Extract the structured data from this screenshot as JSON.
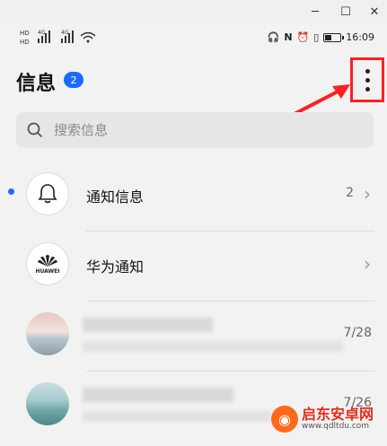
{
  "window": {
    "minimize": "─",
    "maximize": "☐",
    "close": "✕"
  },
  "status_bar": {
    "left_icons": [
      "HD",
      "4G",
      "4G",
      "wifi"
    ],
    "time": "16:09"
  },
  "header": {
    "title": "信息",
    "badge": "2"
  },
  "search": {
    "placeholder": "搜索信息"
  },
  "conversations": [
    {
      "name": "通知信息",
      "meta": "2",
      "unread": true
    },
    {
      "name": "华为通知",
      "meta": "",
      "unread": false,
      "logo_text": "HUAWEI"
    },
    {
      "name": "",
      "meta": "7/28",
      "unread": false
    },
    {
      "name": "",
      "meta": "7/26",
      "unread": false
    }
  ],
  "watermark": {
    "brand": "启东安卓网",
    "url": "www.qdltdu.com"
  },
  "colors": {
    "accent": "#1a6cff",
    "highlight": "#ff1f1f"
  }
}
